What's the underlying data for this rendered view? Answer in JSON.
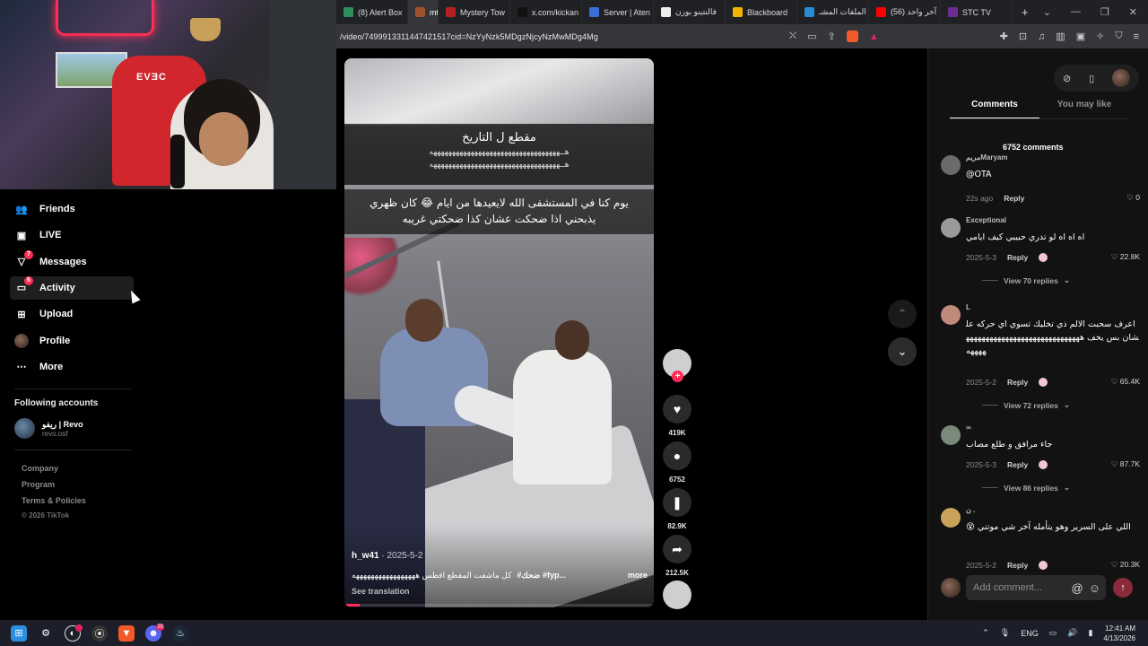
{
  "browser": {
    "tabs": [
      {
        "label": "(8) Alert Box",
        "color": "#2f8f5b",
        "active": false
      },
      {
        "label": "mt",
        "color": "#a0522d",
        "active": true
      },
      {
        "label": "Mystery Tow",
        "color": "#b22222",
        "active": false
      },
      {
        "label": "x.com/kickan",
        "color": "#111111",
        "active": false
      },
      {
        "label": "Server | Aten",
        "color": "#3b6fd8",
        "active": false
      },
      {
        "label": "فالنتينو بورن",
        "color": "#eeeeee",
        "active": false
      },
      {
        "label": "Blackboard",
        "color": "#f2b400",
        "active": false
      },
      {
        "label": "الملفات المشـ",
        "color": "#2a8ad4",
        "active": false
      },
      {
        "label": "(56) آخر واحد",
        "color": "#ff0000",
        "active": false
      },
      {
        "label": "STC TV",
        "color": "#6d2c91",
        "active": false
      }
    ],
    "url": "/video/7499913311447421517cid=NzYyNzk5MDgzNjcyNzMwMDg4Mg"
  },
  "webcam": {
    "chair_logo": "EVƎC"
  },
  "nav": {
    "items": [
      {
        "label": "Friends",
        "icon": "friends-icon",
        "badge": ""
      },
      {
        "label": "LIVE",
        "icon": "live-icon",
        "badge": ""
      },
      {
        "label": "Messages",
        "icon": "messages-icon",
        "badge": "7"
      },
      {
        "label": "Activity",
        "icon": "activity-icon",
        "badge": "6"
      },
      {
        "label": "Upload",
        "icon": "upload-icon",
        "badge": ""
      },
      {
        "label": "Profile",
        "icon": "profile-icon",
        "badge": ""
      },
      {
        "label": "More",
        "icon": "more-icon",
        "badge": ""
      }
    ],
    "following_title": "Following accounts",
    "following": [
      {
        "name": "ريفو | Revo",
        "handle": "revo.osf"
      }
    ],
    "footer": {
      "company": "Company",
      "program": "Program",
      "terms": "Terms & Policies",
      "copyright": "© 2026 TikTok"
    }
  },
  "video": {
    "caption_title": "مقطع ل التاريخ",
    "caption_laugh": "هــههههههههههههههههههههههههههههههههههه",
    "caption_body_1": "يوم كنا في المستشفى الله لايعيدها من ايام 😂 كان ظهري",
    "caption_body_2": "يذبحني اذا ضحكت عشان كذا ضحكتي غريبه",
    "author": "h_w41",
    "date": "· 2025-5-2",
    "desc": "كل ماشفت المقطع افطس هههههههههههههههههه",
    "hashtags": "#ضحك #fyp...",
    "more": "more",
    "see_translation": "See translation",
    "progress": 0.05
  },
  "actions": {
    "likes": "419K",
    "comments": "6752",
    "saves": "82.9K",
    "shares": "212.5K"
  },
  "comments_panel": {
    "tab_comments": "Comments",
    "tab_you_may_like": "You may like",
    "count": "6752 comments",
    "items": [
      {
        "name": "مريمMaryam",
        "text": "@OTA",
        "date": "22s ago",
        "reply": "Reply",
        "likes": "0",
        "liked": false,
        "avatar": "#6b6b6b",
        "view": ""
      },
      {
        "name": "Exceptional",
        "text": "اه اه اه لو تدري حبيبي كيف ايامي",
        "date": "2025-5-3",
        "reply": "Reply",
        "likes": "22.8K",
        "liked": true,
        "avatar": "#9a9a9a",
        "view": "View 70 replies"
      },
      {
        "name": "L",
        "text": "اعرف سحبت الالم ذي تخليك تسوي اي حركه علشان بس يخف ههههههههههههههههههههههههههههههههههه",
        "date": "2025-5-2",
        "reply": "Reply",
        "likes": "65.4K",
        "liked": true,
        "avatar": "#c08a7a",
        "view": "View 72 replies"
      },
      {
        "name": "∞",
        "text": "جاء مرافق و طلع مصاب",
        "date": "2025-5-3",
        "reply": "Reply",
        "likes": "87.7K",
        "liked": true,
        "avatar": "#7a8a7a",
        "view": "View 86 replies"
      },
      {
        "name": "ن .",
        "text": "اللي على السرير وهو يتأمله آخر شي موتني 😵",
        "date": "2025-5-2",
        "reply": "Reply",
        "likes": "20.3K",
        "liked": true,
        "avatar": "#c9a35a",
        "view": ""
      }
    ],
    "composer_placeholder": "Add comment..."
  },
  "taskbar": {
    "lang": "ENG",
    "time": "12:41 AM",
    "date": "4/13/2026",
    "notif_badge_1": "",
    "notif_badge_2": "20"
  }
}
